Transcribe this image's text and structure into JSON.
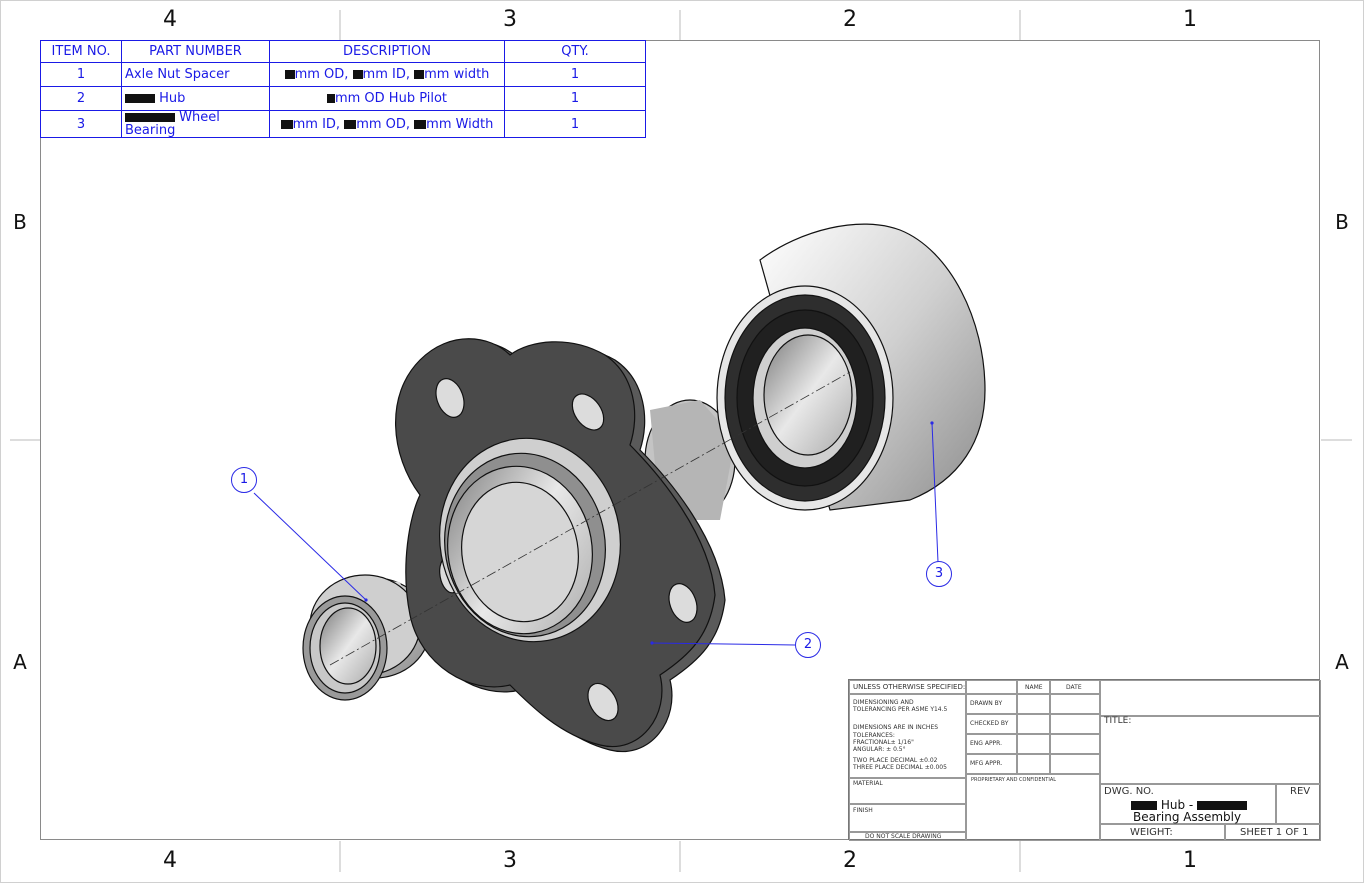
{
  "zones": {
    "columns_top": [
      "4",
      "3",
      "2",
      "1"
    ],
    "columns_bottom": [
      "4",
      "3",
      "2",
      "1"
    ],
    "rows_left": [
      "B",
      "A"
    ],
    "rows_right": [
      "B",
      "A"
    ]
  },
  "bom": {
    "headers": [
      "ITEM NO.",
      "PART NUMBER",
      "DESCRIPTION",
      "QTY."
    ],
    "rows": [
      {
        "item": "1",
        "part": "Axle Nut Spacer",
        "desc_a": "mm OD, ",
        "desc_b": "mm ID, ",
        "desc_c": "mm width",
        "qty": "1"
      },
      {
        "item": "2",
        "part": "Hub",
        "desc_a": "mm OD Hub Pilot",
        "qty": "1"
      },
      {
        "item": "3",
        "part_a": "Wheel",
        "part_b": "Bearing",
        "desc_a": "mm ID, ",
        "desc_b": "mm OD, ",
        "desc_c": "mm Width",
        "qty": "1"
      }
    ]
  },
  "balloons": [
    "1",
    "2",
    "3"
  ],
  "title_block": {
    "unless": "UNLESS OTHERWISE SPECIFIED:",
    "name": "NAME",
    "date": "DATE",
    "dim1": "DIMENSIONING AND",
    "dim2": "TOLERANCING PER ASME Y14.5",
    "dim3": "DIMENSIONS ARE IN INCHES",
    "tol": "TOLERANCES:",
    "frac": "FRACTIONAL± 1/16\"",
    "ang": "ANGULAR: ± 0.5°",
    "two": "TWO PLACE DECIMAL    ±0.02",
    "three": "THREE PLACE DECIMAL  ±0.005",
    "drawn": "DRAWN BY",
    "checked": "CHECKED BY",
    "eng": "ENG APPR.",
    "mfg": "MFG APPR.",
    "prop": "PROPRIETARY AND CONFIDENTIAL",
    "material": "MATERIAL",
    "finish": "FINISH",
    "noscale": "DO NOT SCALE DRAWING",
    "title": "TITLE:",
    "dwg_no": "DWG.  NO.",
    "rev": "REV",
    "dwg_line1": "Hub -",
    "dwg_line2": "Bearing Assembly",
    "weight": "WEIGHT:",
    "sheet": "SHEET 1 OF 1"
  },
  "colors": {
    "annotation": "#1a1ae6",
    "part_dark": "#4a4a4a",
    "part_light": "#d8d8d8"
  }
}
